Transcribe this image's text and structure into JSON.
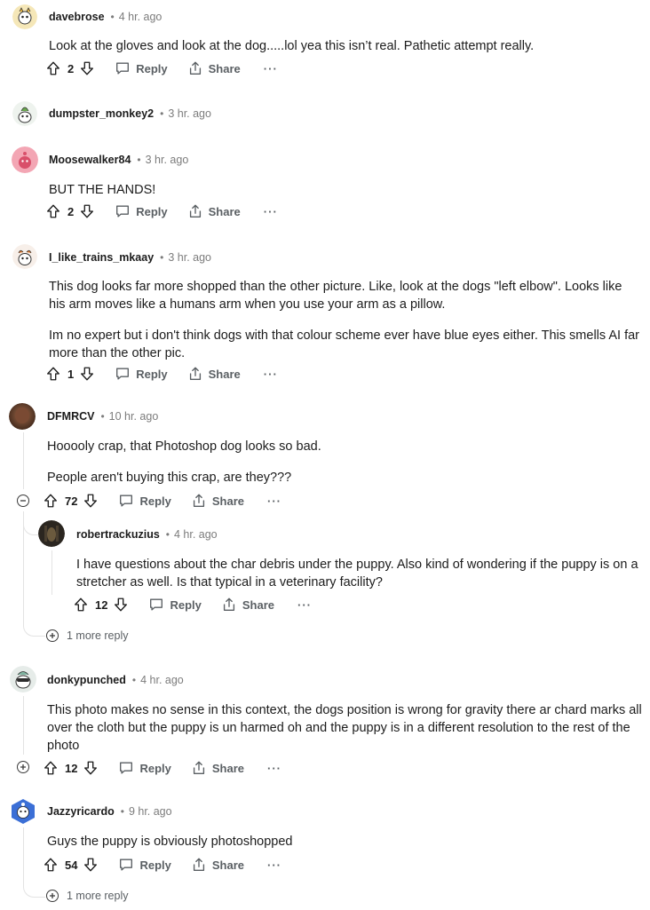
{
  "actions": {
    "reply": "Reply",
    "share": "Share",
    "more": "···"
  },
  "comments": [
    {
      "user": "davebrose",
      "time": "4 hr. ago",
      "score": "2",
      "body": [
        "Look at the gloves and look at the dog.....lol yea this isn’t real. Pathetic attempt really."
      ]
    },
    {
      "user": "dumpster_monkey2",
      "time": "3 hr. ago"
    },
    {
      "user": "Moosewalker84",
      "time": "3 hr. ago",
      "score": "2",
      "body": [
        "BUT THE HANDS!"
      ]
    },
    {
      "user": "I_like_trains_mkaay",
      "time": "3 hr. ago",
      "score": "1",
      "body": [
        "This dog looks far more shopped than the other picture. Like, look at the dogs \"left elbow\". Looks like his arm moves like a humans arm when you use your arm as a pillow.",
        "Im no expert but i don't think dogs with that colour scheme ever have blue eyes either. This smells AI far more than the other pic."
      ]
    },
    {
      "user": "DFMRCV",
      "time": "10 hr. ago",
      "score": "72",
      "body": [
        "Hooooly crap, that Photoshop dog looks so bad.",
        "People aren't buying this crap, are they???"
      ]
    },
    {
      "user": "robertrackuzius",
      "time": "4 hr. ago",
      "score": "12",
      "body": [
        "I have questions about the char debris under the puppy. Also kind of wondering if the puppy is on a stretcher as well. Is that typical in a veterinary facility?"
      ]
    },
    {
      "user": "donkypunched",
      "time": "4 hr. ago",
      "score": "12",
      "body": [
        "This photo makes no sense in this context, the dogs position is wrong for gravity there ar chard marks all over the cloth but the puppy is un harmed oh and the puppy is in a different resolution to the rest of the photo"
      ]
    },
    {
      "user": "Jazzyricardo",
      "time": "9 hr. ago",
      "score": "54",
      "body": [
        "Guys the puppy is obviously photoshopped"
      ]
    }
  ],
  "more_replies": [
    "1 more reply",
    "1 more reply"
  ],
  "dot": "•"
}
